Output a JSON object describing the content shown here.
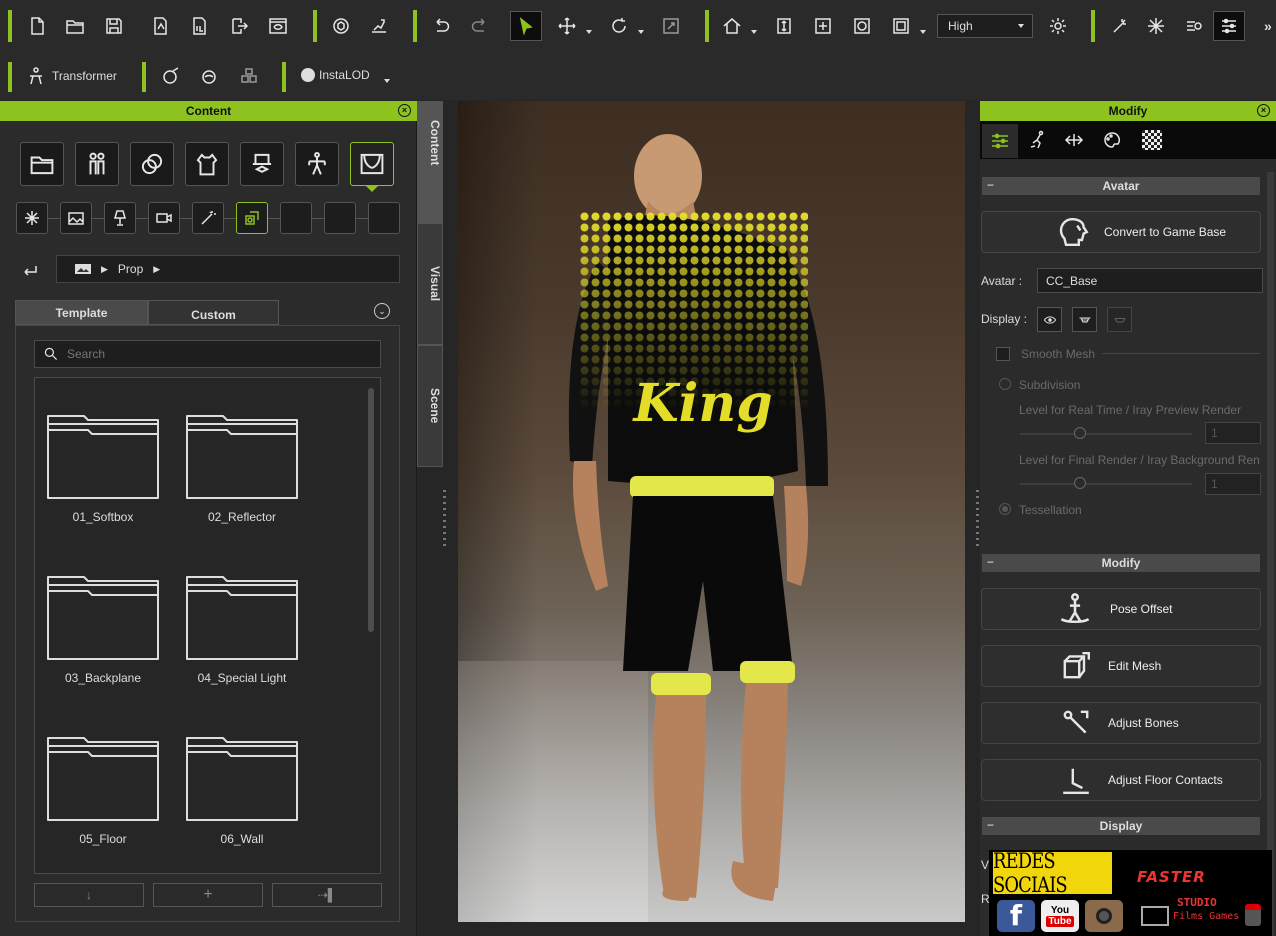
{
  "toolbar": {
    "quality_select": "High",
    "transformer_label": "Transformer",
    "instalod_label": "InstaLOD"
  },
  "content_panel": {
    "title": "Content",
    "breadcrumb": "Prop",
    "tabs": [
      "Template",
      "Custom"
    ],
    "search_placeholder": "Search",
    "folders": [
      "01_Softbox",
      "02_Reflector",
      "03_Backplane",
      "04_Special Light",
      "05_Floor",
      "06_Wall"
    ]
  },
  "side_tabs": [
    "Content",
    "Visual",
    "Scene"
  ],
  "modify_panel": {
    "title": "Modify",
    "avatar_section": "Avatar",
    "convert_button": "Convert to Game Base",
    "avatar_label": "Avatar :",
    "avatar_value": "CC_Base",
    "display_label": "Display :",
    "smooth_mesh": "Smooth Mesh",
    "subdivision": "Subdivision",
    "level_realtime": "Level for Real Time / Iray Preview Render",
    "level_realtime_value": "1",
    "level_final": "Level for Final Render / Iray Background Ren",
    "level_final_value": "1",
    "tessellation": "Tessellation",
    "modify_section": "Modify",
    "pose_offset": "Pose Offset",
    "edit_mesh": "Edit Mesh",
    "adjust_bones": "Adjust Bones",
    "adjust_floor": "Adjust Floor Contacts",
    "display_section": "Display",
    "display_row1_initial": "V",
    "display_row2_initial": "R"
  },
  "overlay": {
    "redes": "REDES SOCIAIS",
    "youtube_you": "You",
    "youtube_tube": "Tube",
    "faster": "FASTER",
    "studio": "STUDIO",
    "films": "Films Games"
  },
  "colors": {
    "accent": "#8dc21f",
    "panel": "#2b2b2b",
    "yellow_banner": "#f2d60c"
  }
}
